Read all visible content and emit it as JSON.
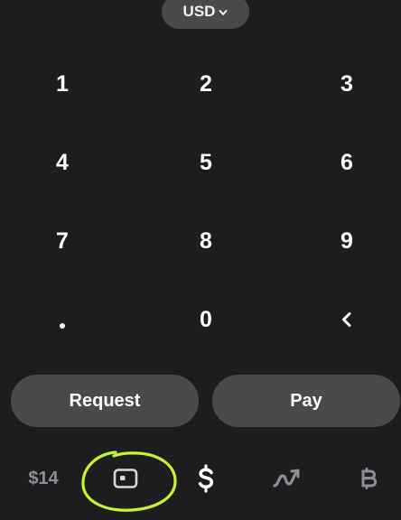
{
  "currency": {
    "label": "USD",
    "icon": "chevron-down-icon"
  },
  "keypad": {
    "keys": [
      "1",
      "2",
      "3",
      "4",
      "5",
      "6",
      "7",
      "8",
      "9",
      ".",
      "0",
      "<"
    ],
    "backspace_icon": "backspace-chevron-icon"
  },
  "actions": {
    "request_label": "Request",
    "pay_label": "Pay"
  },
  "tabbar": {
    "balance_label": "$14",
    "card_icon": "card-icon",
    "dollar_icon": "dollar-icon",
    "investing_icon": "trend-icon",
    "bitcoin_icon": "bitcoin-icon"
  },
  "colors": {
    "background": "#1d1d20",
    "pill": "#4a4a4d",
    "text": "#ffffff",
    "muted": "#8e8e93",
    "highlight": "#c6f432"
  }
}
